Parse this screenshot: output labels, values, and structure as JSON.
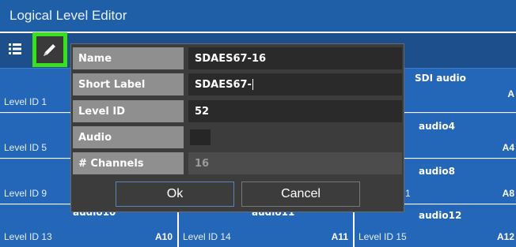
{
  "window": {
    "title": "Logical Level Editor"
  },
  "toolbar": {
    "list_icon": "list-icon",
    "edit_icon": "pencil-icon"
  },
  "tiles": [
    {
      "level_id": "Level ID 1",
      "name": "",
      "code": ""
    },
    {
      "level_id": "",
      "name": "SDI audio",
      "code": "A"
    },
    {
      "level_id": "Level ID 5",
      "name": "",
      "code": ""
    },
    {
      "level_id": "",
      "name": "audio4",
      "code": "A4"
    },
    {
      "level_id": "Level ID 9",
      "name": "",
      "code": ""
    },
    {
      "level_id": "1",
      "name": "audio8",
      "code": "A8"
    },
    {
      "level_id": "Level ID 13",
      "name": "audio10",
      "code": "A10"
    },
    {
      "level_id": "Level ID 14",
      "name": "audio11",
      "code": "A11"
    },
    {
      "level_id": "Level ID 15",
      "name": "audio12",
      "code": "A12"
    }
  ],
  "dialog": {
    "name_label": "Name",
    "name_value": "SDAES67-16",
    "short_label_label": "Short Label",
    "short_label_value": "SDAES67-",
    "level_id_label": "Level ID",
    "level_id_value": "52",
    "audio_label": "Audio",
    "audio_checked": false,
    "channels_label": "# Channels",
    "channels_value": "16",
    "ok_label": "Ok",
    "cancel_label": "Cancel"
  },
  "colors": {
    "title_bg": "#1f5fa8",
    "tile_bg": "#2466b8",
    "dialog_bg": "#3c3c3c",
    "highlight": "#39e01e"
  }
}
